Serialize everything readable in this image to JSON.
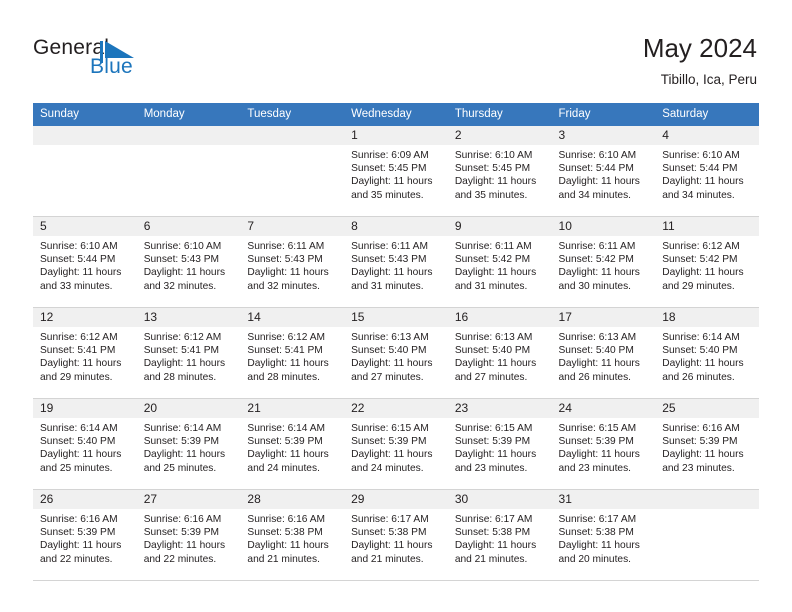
{
  "brand": {
    "name_part1": "General",
    "name_part2": "Blue",
    "mark_icon": "blue-triangle-flag-icon",
    "accent_color": "#1c75bc"
  },
  "header": {
    "title": "May 2024",
    "subtitle": "Tibillo, Ica, Peru"
  },
  "theme": {
    "header_blue": "#3777bc",
    "daynum_gray": "#f0f0f0",
    "grid_line": "#d4d4d4"
  },
  "calendar": {
    "weekday_headers": [
      "Sunday",
      "Monday",
      "Tuesday",
      "Wednesday",
      "Thursday",
      "Friday",
      "Saturday"
    ],
    "weeks": [
      [
        {
          "day": "",
          "sunrise": "",
          "sunset": "",
          "daylight_line1": "",
          "daylight_line2": ""
        },
        {
          "day": "",
          "sunrise": "",
          "sunset": "",
          "daylight_line1": "",
          "daylight_line2": ""
        },
        {
          "day": "",
          "sunrise": "",
          "sunset": "",
          "daylight_line1": "",
          "daylight_line2": ""
        },
        {
          "day": "1",
          "sunrise": "Sunrise: 6:09 AM",
          "sunset": "Sunset: 5:45 PM",
          "daylight_line1": "Daylight: 11 hours",
          "daylight_line2": "and 35 minutes."
        },
        {
          "day": "2",
          "sunrise": "Sunrise: 6:10 AM",
          "sunset": "Sunset: 5:45 PM",
          "daylight_line1": "Daylight: 11 hours",
          "daylight_line2": "and 35 minutes."
        },
        {
          "day": "3",
          "sunrise": "Sunrise: 6:10 AM",
          "sunset": "Sunset: 5:44 PM",
          "daylight_line1": "Daylight: 11 hours",
          "daylight_line2": "and 34 minutes."
        },
        {
          "day": "4",
          "sunrise": "Sunrise: 6:10 AM",
          "sunset": "Sunset: 5:44 PM",
          "daylight_line1": "Daylight: 11 hours",
          "daylight_line2": "and 34 minutes."
        }
      ],
      [
        {
          "day": "5",
          "sunrise": "Sunrise: 6:10 AM",
          "sunset": "Sunset: 5:44 PM",
          "daylight_line1": "Daylight: 11 hours",
          "daylight_line2": "and 33 minutes."
        },
        {
          "day": "6",
          "sunrise": "Sunrise: 6:10 AM",
          "sunset": "Sunset: 5:43 PM",
          "daylight_line1": "Daylight: 11 hours",
          "daylight_line2": "and 32 minutes."
        },
        {
          "day": "7",
          "sunrise": "Sunrise: 6:11 AM",
          "sunset": "Sunset: 5:43 PM",
          "daylight_line1": "Daylight: 11 hours",
          "daylight_line2": "and 32 minutes."
        },
        {
          "day": "8",
          "sunrise": "Sunrise: 6:11 AM",
          "sunset": "Sunset: 5:43 PM",
          "daylight_line1": "Daylight: 11 hours",
          "daylight_line2": "and 31 minutes."
        },
        {
          "day": "9",
          "sunrise": "Sunrise: 6:11 AM",
          "sunset": "Sunset: 5:42 PM",
          "daylight_line1": "Daylight: 11 hours",
          "daylight_line2": "and 31 minutes."
        },
        {
          "day": "10",
          "sunrise": "Sunrise: 6:11 AM",
          "sunset": "Sunset: 5:42 PM",
          "daylight_line1": "Daylight: 11 hours",
          "daylight_line2": "and 30 minutes."
        },
        {
          "day": "11",
          "sunrise": "Sunrise: 6:12 AM",
          "sunset": "Sunset: 5:42 PM",
          "daylight_line1": "Daylight: 11 hours",
          "daylight_line2": "and 29 minutes."
        }
      ],
      [
        {
          "day": "12",
          "sunrise": "Sunrise: 6:12 AM",
          "sunset": "Sunset: 5:41 PM",
          "daylight_line1": "Daylight: 11 hours",
          "daylight_line2": "and 29 minutes."
        },
        {
          "day": "13",
          "sunrise": "Sunrise: 6:12 AM",
          "sunset": "Sunset: 5:41 PM",
          "daylight_line1": "Daylight: 11 hours",
          "daylight_line2": "and 28 minutes."
        },
        {
          "day": "14",
          "sunrise": "Sunrise: 6:12 AM",
          "sunset": "Sunset: 5:41 PM",
          "daylight_line1": "Daylight: 11 hours",
          "daylight_line2": "and 28 minutes."
        },
        {
          "day": "15",
          "sunrise": "Sunrise: 6:13 AM",
          "sunset": "Sunset: 5:40 PM",
          "daylight_line1": "Daylight: 11 hours",
          "daylight_line2": "and 27 minutes."
        },
        {
          "day": "16",
          "sunrise": "Sunrise: 6:13 AM",
          "sunset": "Sunset: 5:40 PM",
          "daylight_line1": "Daylight: 11 hours",
          "daylight_line2": "and 27 minutes."
        },
        {
          "day": "17",
          "sunrise": "Sunrise: 6:13 AM",
          "sunset": "Sunset: 5:40 PM",
          "daylight_line1": "Daylight: 11 hours",
          "daylight_line2": "and 26 minutes."
        },
        {
          "day": "18",
          "sunrise": "Sunrise: 6:14 AM",
          "sunset": "Sunset: 5:40 PM",
          "daylight_line1": "Daylight: 11 hours",
          "daylight_line2": "and 26 minutes."
        }
      ],
      [
        {
          "day": "19",
          "sunrise": "Sunrise: 6:14 AM",
          "sunset": "Sunset: 5:40 PM",
          "daylight_line1": "Daylight: 11 hours",
          "daylight_line2": "and 25 minutes."
        },
        {
          "day": "20",
          "sunrise": "Sunrise: 6:14 AM",
          "sunset": "Sunset: 5:39 PM",
          "daylight_line1": "Daylight: 11 hours",
          "daylight_line2": "and 25 minutes."
        },
        {
          "day": "21",
          "sunrise": "Sunrise: 6:14 AM",
          "sunset": "Sunset: 5:39 PM",
          "daylight_line1": "Daylight: 11 hours",
          "daylight_line2": "and 24 minutes."
        },
        {
          "day": "22",
          "sunrise": "Sunrise: 6:15 AM",
          "sunset": "Sunset: 5:39 PM",
          "daylight_line1": "Daylight: 11 hours",
          "daylight_line2": "and 24 minutes."
        },
        {
          "day": "23",
          "sunrise": "Sunrise: 6:15 AM",
          "sunset": "Sunset: 5:39 PM",
          "daylight_line1": "Daylight: 11 hours",
          "daylight_line2": "and 23 minutes."
        },
        {
          "day": "24",
          "sunrise": "Sunrise: 6:15 AM",
          "sunset": "Sunset: 5:39 PM",
          "daylight_line1": "Daylight: 11 hours",
          "daylight_line2": "and 23 minutes."
        },
        {
          "day": "25",
          "sunrise": "Sunrise: 6:16 AM",
          "sunset": "Sunset: 5:39 PM",
          "daylight_line1": "Daylight: 11 hours",
          "daylight_line2": "and 23 minutes."
        }
      ],
      [
        {
          "day": "26",
          "sunrise": "Sunrise: 6:16 AM",
          "sunset": "Sunset: 5:39 PM",
          "daylight_line1": "Daylight: 11 hours",
          "daylight_line2": "and 22 minutes."
        },
        {
          "day": "27",
          "sunrise": "Sunrise: 6:16 AM",
          "sunset": "Sunset: 5:39 PM",
          "daylight_line1": "Daylight: 11 hours",
          "daylight_line2": "and 22 minutes."
        },
        {
          "day": "28",
          "sunrise": "Sunrise: 6:16 AM",
          "sunset": "Sunset: 5:38 PM",
          "daylight_line1": "Daylight: 11 hours",
          "daylight_line2": "and 21 minutes."
        },
        {
          "day": "29",
          "sunrise": "Sunrise: 6:17 AM",
          "sunset": "Sunset: 5:38 PM",
          "daylight_line1": "Daylight: 11 hours",
          "daylight_line2": "and 21 minutes."
        },
        {
          "day": "30",
          "sunrise": "Sunrise: 6:17 AM",
          "sunset": "Sunset: 5:38 PM",
          "daylight_line1": "Daylight: 11 hours",
          "daylight_line2": "and 21 minutes."
        },
        {
          "day": "31",
          "sunrise": "Sunrise: 6:17 AM",
          "sunset": "Sunset: 5:38 PM",
          "daylight_line1": "Daylight: 11 hours",
          "daylight_line2": "and 20 minutes."
        },
        {
          "day": "",
          "sunrise": "",
          "sunset": "",
          "daylight_line1": "",
          "daylight_line2": ""
        }
      ]
    ]
  }
}
